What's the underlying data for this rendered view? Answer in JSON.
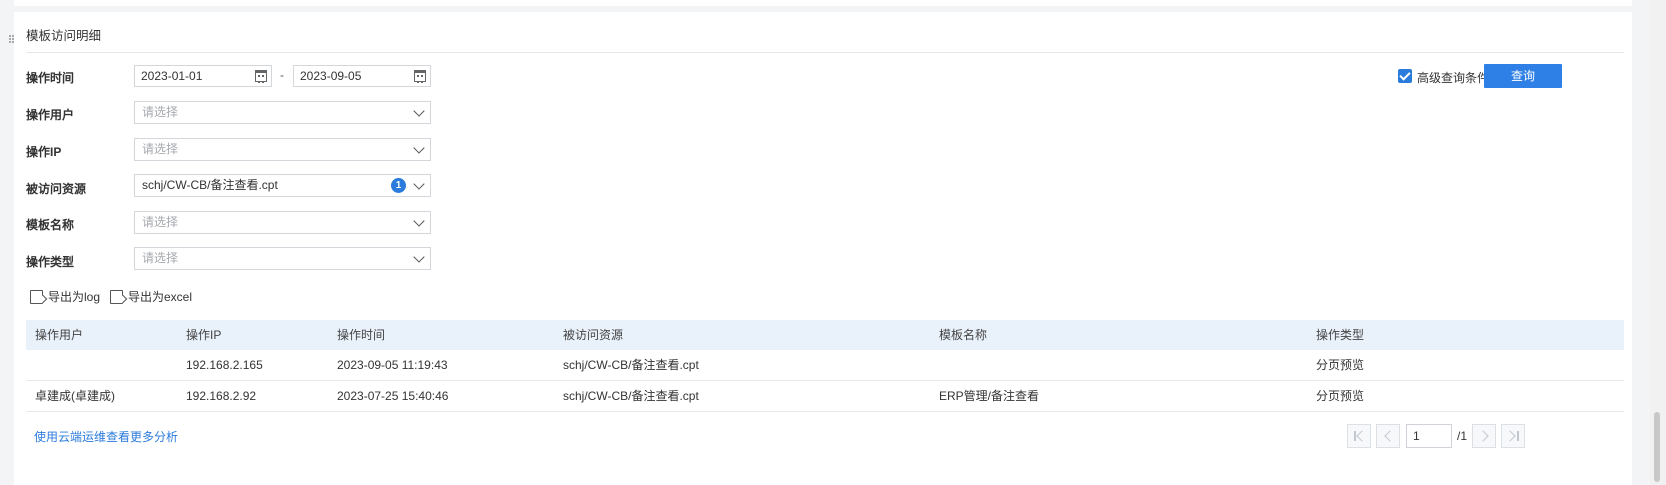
{
  "panel": {
    "title": "模板访问明细"
  },
  "filters": {
    "op_time_label": "操作时间",
    "date_from": "2023-01-01",
    "date_sep": "-",
    "date_to": "2023-09-05",
    "op_user_label": "操作用户",
    "op_user_placeholder": "请选择",
    "op_ip_label": "操作IP",
    "op_ip_placeholder": "请选择",
    "resource_label": "被访问资源",
    "resource_value": "schj/CW-CB/备注查看.cpt",
    "resource_count": "1",
    "template_label": "模板名称",
    "template_placeholder": "请选择",
    "op_type_label": "操作类型",
    "op_type_placeholder": "请选择",
    "advanced_label": "高级查询条件",
    "advanced_checked": true,
    "query_button": "查询"
  },
  "toolbar": {
    "export_log": "导出为log",
    "export_excel": "导出为excel"
  },
  "table": {
    "columns": [
      "操作用户",
      "操作IP",
      "操作时间",
      "被访问资源",
      "模板名称",
      "操作类型"
    ],
    "rows": [
      [
        "",
        "192.168.2.165",
        "2023-09-05 11:19:43",
        "schj/CW-CB/备注查看.cpt",
        "",
        "分页预览"
      ],
      [
        "卓建成(卓建成)",
        "192.168.2.92",
        "2023-07-25 15:40:46",
        "schj/CW-CB/备注查看.cpt",
        "ERP管理/备注查看",
        "分页预览"
      ]
    ]
  },
  "footer": {
    "more_link": "使用云端运维查看更多分析",
    "page_current": "1",
    "page_total": "/1"
  },
  "colors": {
    "accent": "#2f80e6",
    "header_bg": "#e9f1fb"
  }
}
